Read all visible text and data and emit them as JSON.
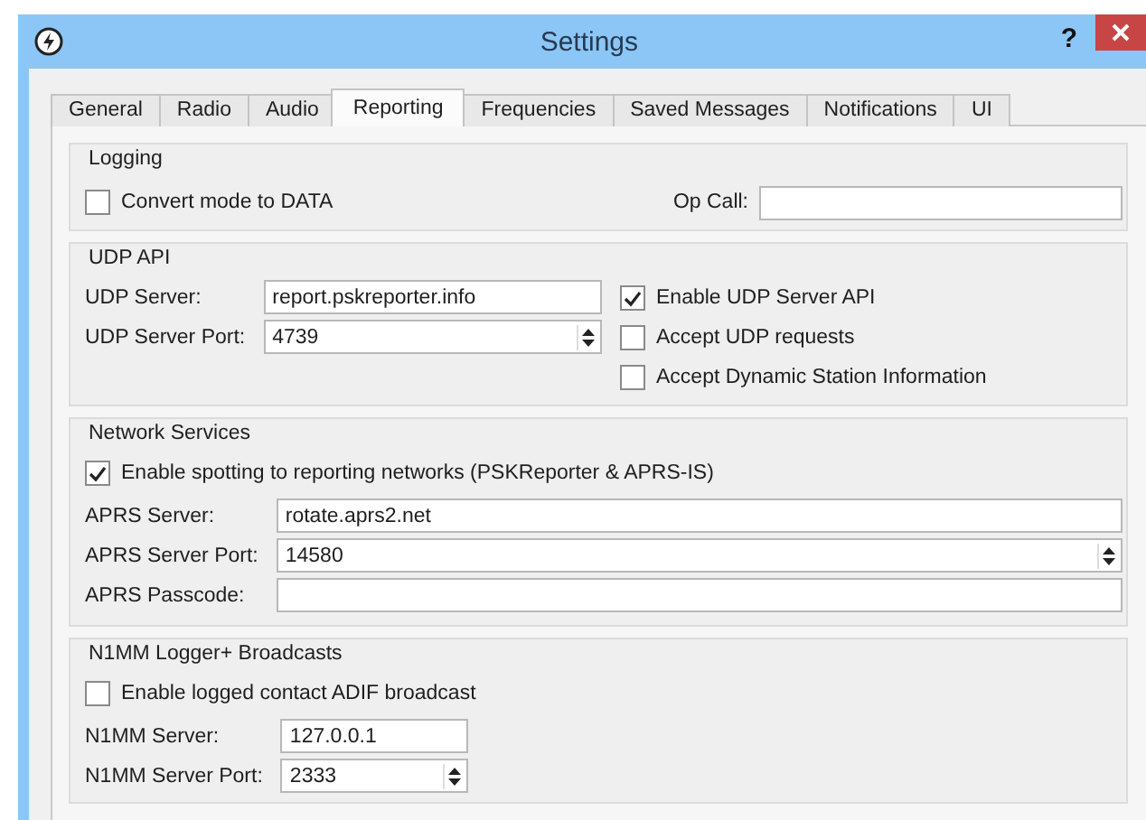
{
  "window": {
    "title": "Settings",
    "help": "?"
  },
  "tabs": [
    {
      "label": "General",
      "selected": false
    },
    {
      "label": "Radio",
      "selected": false
    },
    {
      "label": "Audio",
      "selected": false
    },
    {
      "label": "Reporting",
      "selected": true
    },
    {
      "label": "Frequencies",
      "selected": false
    },
    {
      "label": "Saved Messages",
      "selected": false
    },
    {
      "label": "Notifications",
      "selected": false
    },
    {
      "label": "UI",
      "selected": false
    }
  ],
  "groups": [
    {
      "title": "Logging",
      "kind": "inline",
      "items": [
        {
          "kind": "checkbox",
          "label": "Convert mode to DATA",
          "checked": false
        },
        {
          "kind": "field",
          "label": "Op Call:"
        }
      ]
    },
    {
      "title": "UDP API",
      "kind": "split",
      "items": [
        {
          "kind": "field",
          "label": "UDP Server:",
          "value": "report.pskreporter.info"
        },
        {
          "kind": "spin",
          "label": "UDP Server Port:",
          "value": "4739"
        },
        {
          "kind": "checkbox",
          "label": "Enable UDP Server API",
          "checked": true
        },
        {
          "kind": "checkbox",
          "label": "Accept UDP requests",
          "checked": false
        },
        {
          "kind": "checkbox",
          "label": "Accept Dynamic Station Information",
          "checked": false
        }
      ]
    },
    {
      "title": "Network Services",
      "kind": "wide",
      "items": [
        {
          "kind": "checkbox",
          "label": "Enable spotting to reporting networks (PSKReporter & APRS-IS)",
          "checked": true
        },
        {
          "kind": "field",
          "label": "APRS Server:",
          "value": "rotate.aprs2.net"
        },
        {
          "kind": "spin",
          "label": "APRS Server Port:",
          "value": "14580"
        },
        {
          "kind": "field",
          "label": "APRS Passcode:"
        }
      ]
    },
    {
      "title": "N1MM Logger+  Broadcasts",
      "kind": "narrow",
      "items": [
        {
          "kind": "checkbox",
          "label": "Enable logged contact ADIF broadcast",
          "checked": false
        },
        {
          "kind": "field",
          "label": "N1MM Server:",
          "value": "127.0.0.1"
        },
        {
          "kind": "spin",
          "label": "N1MM Server Port:",
          "value": "2333"
        }
      ]
    }
  ]
}
